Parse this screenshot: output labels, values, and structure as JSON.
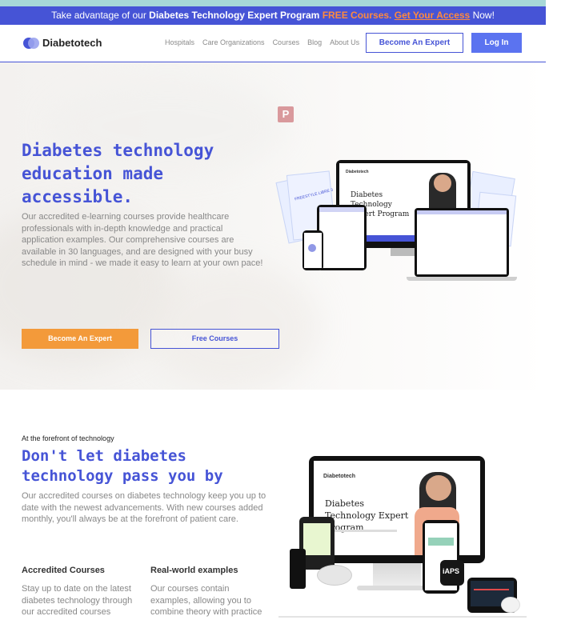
{
  "announcement": {
    "prefix": "Take advantage of our",
    "program": "Diabetes Technology Expert Program",
    "free": "FREE Courses.",
    "cta": "Get Your Access",
    "suffix": "Now!"
  },
  "nav": {
    "logo": "Diabetotech",
    "links": [
      "Hospitals",
      "Care Organizations",
      "Courses",
      "Blog",
      "About Us"
    ],
    "expert_button": "Become An Expert",
    "login_button": "Log In"
  },
  "hero": {
    "title": "Diabetes technology education made accessible.",
    "description": "Our accredited e-learning courses provide healthcare professionals with in-depth knowledge and practical application examples. Our comprehensive courses are available in 30 languages, and are designed with your busy schedule in mind - we made it easy to learn at your own pace!",
    "primary_button": "Become An Expert",
    "secondary_button": "Free Courses",
    "pin_icon": "pinterest-icon",
    "mockup": {
      "brand": "Diabetotech",
      "screen_title": "Diabetes Technology Expert Program",
      "book_label": "FREESTYLE LIBRE 3"
    }
  },
  "section": {
    "kicker": "At the forefront of technology",
    "title": "Don't let diabetes technology pass you by",
    "description": "Our accredited courses on diabetes technology keep you up to date with the newest advancements. With new courses added monthly, you'll always be at the forefront of patient care.",
    "features": [
      {
        "title": "Accredited Courses",
        "text": "Stay up to date on the latest diabetes technology through our accredited courses"
      },
      {
        "title": "Real-world examples",
        "text": "Our courses contain examples, allowing you to combine theory with practice"
      }
    ],
    "mockup": {
      "brand": "Diabetotech",
      "screen_title": "Diabetes Technology Expert Program",
      "device_label": "iAPS"
    }
  },
  "colors": {
    "brand_blue": "#4654d6",
    "accent_orange": "#f39a3a",
    "login_blue": "#5b73f0"
  }
}
